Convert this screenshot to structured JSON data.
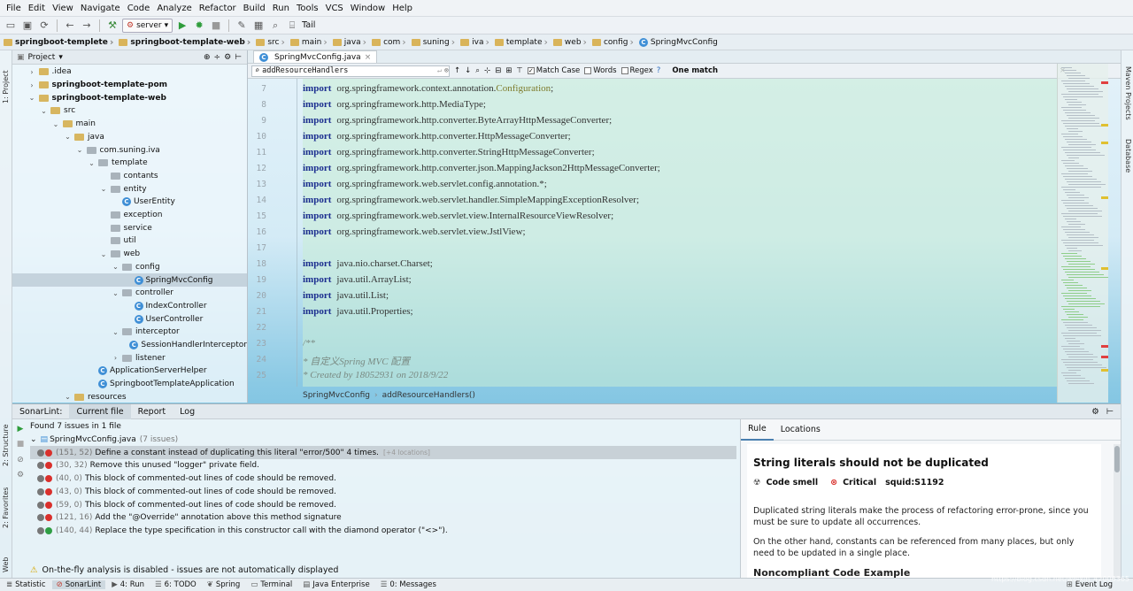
{
  "menu": [
    "File",
    "Edit",
    "View",
    "Navigate",
    "Code",
    "Analyze",
    "Refactor",
    "Build",
    "Run",
    "Tools",
    "VCS",
    "Window",
    "Help"
  ],
  "toolbar": {
    "run_config": "server",
    "tail_label": "Tail"
  },
  "breadcrumbs": [
    "springboot-templete",
    "springboot-template-web",
    "src",
    "main",
    "java",
    "com",
    "suning",
    "iva",
    "template",
    "web",
    "config",
    "SpringMvcConfig"
  ],
  "project": {
    "title": "Project",
    "items": [
      {
        "label": ".idea",
        "depth": 1,
        "arrow": "›",
        "icon": "folder"
      },
      {
        "label": "springboot-template-pom",
        "depth": 1,
        "arrow": "›",
        "icon": "folder",
        "bold": true
      },
      {
        "label": "springboot-template-web",
        "depth": 1,
        "arrow": "⌄",
        "icon": "folder",
        "bold": true
      },
      {
        "label": "src",
        "depth": 2,
        "arrow": "⌄",
        "icon": "folder"
      },
      {
        "label": "main",
        "depth": 3,
        "arrow": "⌄",
        "icon": "folder"
      },
      {
        "label": "java",
        "depth": 4,
        "arrow": "⌄",
        "icon": "folder"
      },
      {
        "label": "com.suning.iva",
        "depth": 5,
        "arrow": "⌄",
        "icon": "package"
      },
      {
        "label": "template",
        "depth": 6,
        "arrow": "⌄",
        "icon": "package"
      },
      {
        "label": "contants",
        "depth": 7,
        "arrow": "",
        "icon": "package"
      },
      {
        "label": "entity",
        "depth": 7,
        "arrow": "⌄",
        "icon": "package"
      },
      {
        "label": "UserEntity",
        "depth": 8,
        "arrow": "",
        "icon": "class"
      },
      {
        "label": "exception",
        "depth": 7,
        "arrow": "",
        "icon": "package"
      },
      {
        "label": "service",
        "depth": 7,
        "arrow": "",
        "icon": "package"
      },
      {
        "label": "util",
        "depth": 7,
        "arrow": "",
        "icon": "package"
      },
      {
        "label": "web",
        "depth": 7,
        "arrow": "⌄",
        "icon": "package"
      },
      {
        "label": "config",
        "depth": 8,
        "arrow": "⌄",
        "icon": "package"
      },
      {
        "label": "SpringMvcConfig",
        "depth": 9,
        "arrow": "",
        "icon": "class",
        "selected": true
      },
      {
        "label": "controller",
        "depth": 8,
        "arrow": "⌄",
        "icon": "package"
      },
      {
        "label": "IndexController",
        "depth": 9,
        "arrow": "",
        "icon": "class"
      },
      {
        "label": "UserController",
        "depth": 9,
        "arrow": "",
        "icon": "class"
      },
      {
        "label": "interceptor",
        "depth": 8,
        "arrow": "⌄",
        "icon": "package"
      },
      {
        "label": "SessionHandlerInterceptor",
        "depth": 9,
        "arrow": "",
        "icon": "class"
      },
      {
        "label": "listener",
        "depth": 8,
        "arrow": "›",
        "icon": "package"
      },
      {
        "label": "ApplicationServerHelper",
        "depth": 6,
        "arrow": "",
        "icon": "class"
      },
      {
        "label": "SpringbootTemplateApplication",
        "depth": 6,
        "arrow": "",
        "icon": "class"
      },
      {
        "label": "resources",
        "depth": 4,
        "arrow": "⌄",
        "icon": "folder"
      }
    ]
  },
  "editor": {
    "tab": "SpringMvcConfig.java",
    "search": "addResourceHandlers",
    "match_case": "Match Case",
    "words": "Words",
    "regex": "Regex",
    "match_count": "One match",
    "lines": [
      {
        "n": "7",
        "kw": "import",
        "text": "org.springframework.context.annotation.",
        "ann": "Configuration",
        "tail": ";"
      },
      {
        "n": "8",
        "kw": "import",
        "text": "org.springframework.http.MediaType;"
      },
      {
        "n": "9",
        "kw": "import",
        "text": "org.springframework.http.converter.ByteArrayHttpMessageConverter;"
      },
      {
        "n": "10",
        "kw": "import",
        "text": "org.springframework.http.converter.HttpMessageConverter;"
      },
      {
        "n": "11",
        "kw": "import",
        "text": "org.springframework.http.converter.StringHttpMessageConverter;"
      },
      {
        "n": "12",
        "kw": "import",
        "text": "org.springframework.http.converter.json.MappingJackson2HttpMessageConverter;"
      },
      {
        "n": "13",
        "kw": "import",
        "text": "org.springframework.web.servlet.config.annotation.*;"
      },
      {
        "n": "14",
        "kw": "import",
        "text": "org.springframework.web.servlet.handler.SimpleMappingExceptionResolver;"
      },
      {
        "n": "15",
        "kw": "import",
        "text": "org.springframework.web.servlet.view.InternalResourceViewResolver;"
      },
      {
        "n": "16",
        "kw": "import",
        "text": "org.springframework.web.servlet.view.JstlView;"
      },
      {
        "n": "17",
        "kw": "",
        "text": ""
      },
      {
        "n": "18",
        "kw": "import",
        "text": "java.nio.charset.Charset;"
      },
      {
        "n": "19",
        "kw": "import",
        "text": "java.util.ArrayList;"
      },
      {
        "n": "20",
        "kw": "import",
        "text": "java.util.List;"
      },
      {
        "n": "21",
        "kw": "import",
        "text": "java.util.Properties;"
      },
      {
        "n": "22",
        "kw": "",
        "text": ""
      },
      {
        "n": "23",
        "kw": "",
        "cmt": "/**"
      },
      {
        "n": "24",
        "kw": "",
        "cmt": " * 自定义Spring MVC 配置"
      },
      {
        "n": "25",
        "kw": "",
        "cmt": " * Created by 18052931 on 2018/9/22"
      }
    ],
    "crumb": [
      "SpringMvcConfig",
      "addResourceHandlers()"
    ]
  },
  "sonar": {
    "tabs": [
      "SonarLint:",
      "Current file",
      "Report",
      "Log"
    ],
    "found": "Found 7 issues in 1 file",
    "file": "SpringMvcConfig.java",
    "file_count": "(7 issues)",
    "issues": [
      {
        "pos": "(151, 52)",
        "msg": "Define a constant instead of duplicating this literal \"error/500\" 4 times.",
        "extra": "[+4 locations]",
        "sev": "critical"
      },
      {
        "pos": "(30, 32)",
        "msg": "Remove this unused \"logger\" private field.",
        "sev": "major"
      },
      {
        "pos": "(40, 0)",
        "msg": "This block of commented-out lines of code should be removed.",
        "sev": "major"
      },
      {
        "pos": "(43, 0)",
        "msg": "This block of commented-out lines of code should be removed.",
        "sev": "major"
      },
      {
        "pos": "(59, 0)",
        "msg": "This block of commented-out lines of code should be removed.",
        "sev": "major"
      },
      {
        "pos": "(121, 16)",
        "msg": "Add the \"@Override\" annotation above this method signature",
        "sev": "major"
      },
      {
        "pos": "(140, 44)",
        "msg": "Replace the type specification in this constructor call with the diamond operator (\"<>\").",
        "sev": "minor"
      }
    ],
    "warning": "On-the-fly analysis is disabled - issues are not automatically displayed"
  },
  "rule": {
    "tabs": [
      "Rule",
      "Locations"
    ],
    "title": "String literals should not be duplicated",
    "type": "Code smell",
    "severity": "Critical",
    "key": "squid:S1192",
    "p1": "Duplicated string literals make the process of refactoring error-prone, since you must be sure to update all occurrences.",
    "p2": "On the other hand, constants can be referenced from many places, but only need to be updated in a single place.",
    "p3": "Noncompliant Code Example"
  },
  "left_tools": [
    "1: Project",
    "2: Structure",
    "2: Favorites",
    "Web"
  ],
  "right_tools": [
    "Maven Projects",
    "Database"
  ],
  "status": [
    "Statistic",
    "SonarLint",
    "4: Run",
    "6: TODO",
    "Spring",
    "Terminal",
    "Java Enterprise",
    "0: Messages",
    "Event Log"
  ],
  "watermark": "https://blog.csdn.net/weixin_42006365",
  "colors": {
    "critical": "#d9302c",
    "major": "#d9302c",
    "minor": "#2f9e44",
    "keyword": "#1b2d8f"
  }
}
